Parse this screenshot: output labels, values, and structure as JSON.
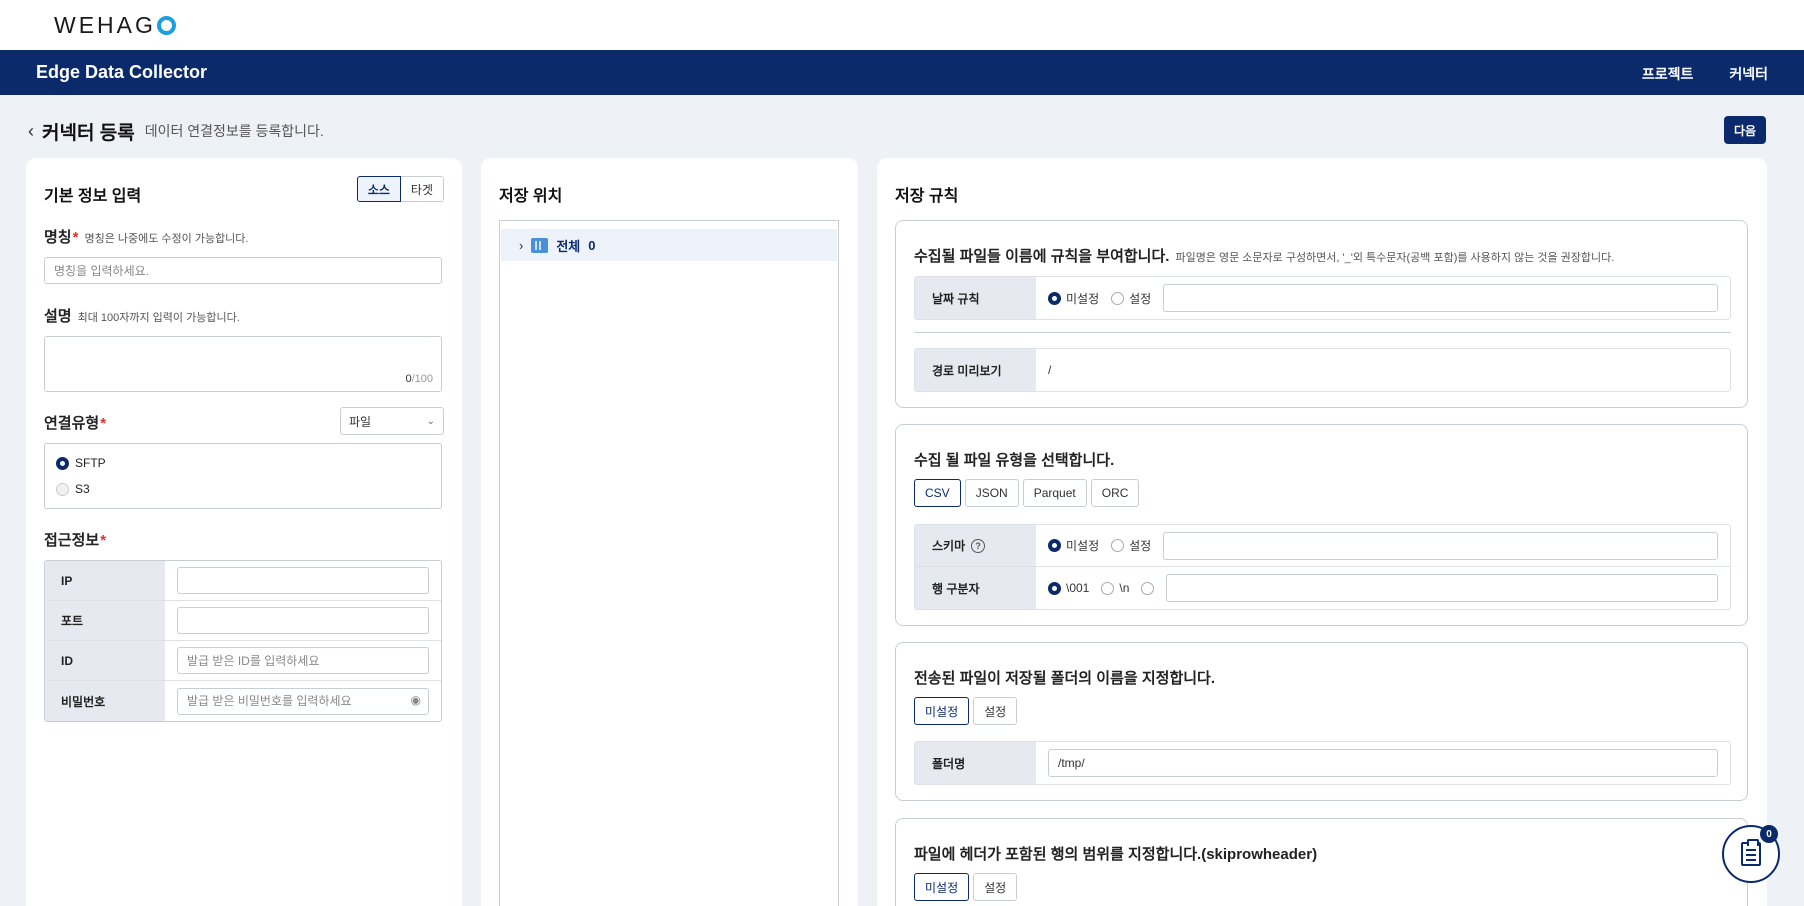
{
  "brand": {
    "logo_text": "WEHAG"
  },
  "navbar": {
    "title": "Edge Data Collector",
    "menu": [
      "프로젝트",
      "커넥터"
    ]
  },
  "page": {
    "title": "커넥터 등록",
    "subtitle": "데이터 연결정보를 등록합니다.",
    "next_label": "다음"
  },
  "basic": {
    "title": "기본 정보 입력",
    "toggle": [
      "소스",
      "타겟"
    ],
    "name_label": "명칭",
    "name_hint": "명칭은 나중에도 수정이 가능합니다.",
    "name_placeholder": "명칭을 입력하세요.",
    "desc_label": "설명",
    "desc_hint": "최대 100자까지 입력이 가능합니다.",
    "desc_count": "0",
    "desc_max": "/100",
    "conn_label": "연결유형",
    "conn_select": "파일",
    "conn_options": [
      "SFTP",
      "S3"
    ],
    "access_label": "접근정보",
    "access_rows": [
      {
        "key": "IP",
        "placeholder": ""
      },
      {
        "key": "포트",
        "placeholder": ""
      },
      {
        "key": "ID",
        "placeholder": "발급 받은 ID를 입력하세요"
      },
      {
        "key": "비밀번호",
        "placeholder": "발급 받은 비밀번호를 입력하세요"
      }
    ]
  },
  "storage": {
    "title": "저장 위치",
    "tree_label": "전체",
    "tree_count": "0"
  },
  "rules": {
    "title": "저장 규칙",
    "filename": {
      "title": "수집될 파일들 이름에 규칙을 부여합니다.",
      "hint": "파일명은 영문 소문자로 구성하면서, '_'외 특수문자(공백 포함)를 사용하지 않는 것을 권장합니다.",
      "date_rule_label": "날짜 규칙",
      "opt_unset": "미설정",
      "opt_set": "설정",
      "preview_label": "경로 미리보기",
      "preview_value": "/"
    },
    "filetype": {
      "title": "수집 될 파일 유형을 선택합니다.",
      "types": [
        "CSV",
        "JSON",
        "Parquet",
        "ORC"
      ],
      "schema_label": "스키마",
      "help_glyph": "?",
      "opt_unset": "미설정",
      "opt_set": "설정",
      "row_sep_label": "행 구분자",
      "row_sep_opts": [
        "\\001",
        "\\n"
      ]
    },
    "folder": {
      "title": "전송된 파일이 저장될 폴더의 이름을 지정합니다.",
      "toggle": [
        "미설정",
        "설정"
      ],
      "folder_label": "폴더명",
      "folder_value": "/tmp/"
    },
    "skiprow": {
      "title": "파일에 헤더가 포함된 행의 범위를 지정합니다.(skiprowheader)",
      "toggle": [
        "미설정",
        "설정"
      ]
    }
  },
  "fab": {
    "badge": "0"
  },
  "colors": {
    "brand": "#0a2a6b",
    "logo_accent": "#1aa0e0",
    "required": "#e03030"
  }
}
